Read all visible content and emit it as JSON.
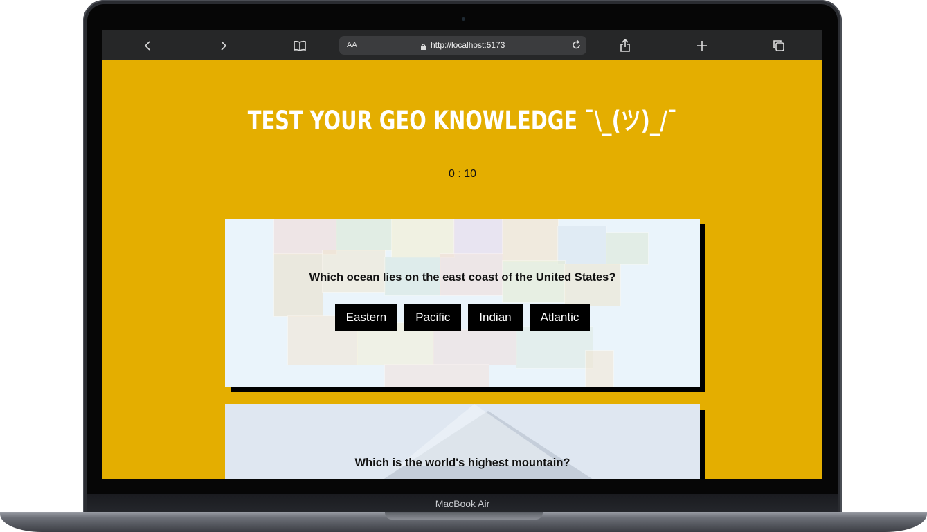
{
  "device": {
    "label": "MacBook Air"
  },
  "browser": {
    "text_size_label": "AA",
    "url": "http://localhost:5173",
    "icons": [
      "back-icon",
      "forward-icon",
      "bookmarks-icon",
      "lock-icon",
      "reload-icon",
      "share-icon",
      "new-tab-icon",
      "tabs-icon"
    ]
  },
  "page": {
    "title": "TEST YOUR GEO KNOWLEDGE ¯\\_(ツ)_/¯",
    "timer": "0 : 10",
    "background": "#e4ae00"
  },
  "questions": [
    {
      "text": "Which ocean lies on the east coast of the United States?",
      "answers": [
        "Eastern",
        "Pacific",
        "Indian",
        "Atlantic"
      ]
    },
    {
      "text": "Which is the world's highest mountain?"
    }
  ]
}
